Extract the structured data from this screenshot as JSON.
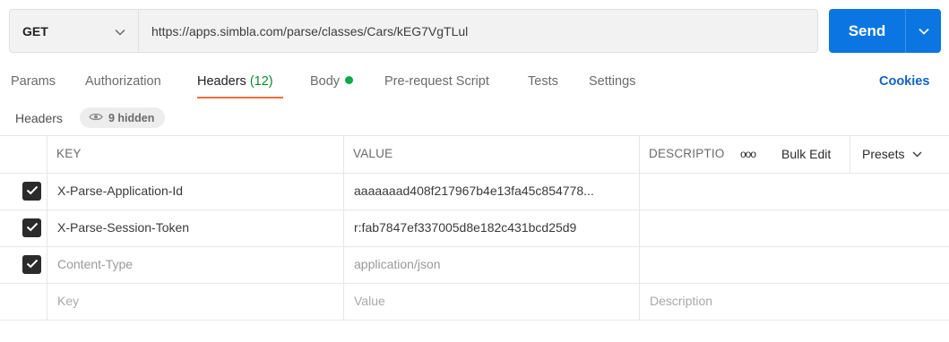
{
  "request": {
    "method": "GET",
    "url": "https://apps.simbla.com/parse/classes/Cars/kEG7VgTLul",
    "send_label": "Send"
  },
  "tabs": [
    {
      "label": "Params"
    },
    {
      "label": "Authorization"
    },
    {
      "label": "Headers",
      "count": "(12)",
      "active": true
    },
    {
      "label": "Body",
      "has_dot": true
    },
    {
      "label": "Pre-request Script"
    },
    {
      "label": "Tests"
    },
    {
      "label": "Settings"
    }
  ],
  "cookies_label": "Cookies",
  "headers_section": {
    "title": "Headers",
    "hidden_label": "9 hidden"
  },
  "table": {
    "columns": {
      "key": "KEY",
      "value": "VALUE",
      "description": "DESCRIPTIO"
    },
    "tools": {
      "more": "ooo",
      "bulk_edit": "Bulk Edit",
      "presets": "Presets"
    },
    "rows": [
      {
        "checked": true,
        "key": "X-Parse-Application-Id",
        "value": "aaaaaaad408f217967b4e13fa45c854778...",
        "description": "",
        "muted": false
      },
      {
        "checked": true,
        "key": "X-Parse-Session-Token",
        "value": "r:fab7847ef337005d8e182c431bcd25d9",
        "description": "",
        "muted": false
      },
      {
        "checked": true,
        "key": "Content-Type",
        "value": "application/json",
        "description": "",
        "muted": true
      }
    ],
    "placeholder_row": {
      "key": "Key",
      "value": "Value",
      "description": "Description"
    }
  },
  "colors": {
    "send_button": "#0b76e1",
    "active_tab_underline": "#f26b3a",
    "header_count": "#0a8a2e",
    "body_dot": "#0ca84a",
    "cookies_link": "#1062c6"
  },
  "icons": {
    "method_caret": "chevron-down-icon",
    "send_caret": "chevron-down-icon",
    "hidden": "eye-icon",
    "checkbox": "checkmark-icon",
    "presets_caret": "chevron-down-icon"
  }
}
